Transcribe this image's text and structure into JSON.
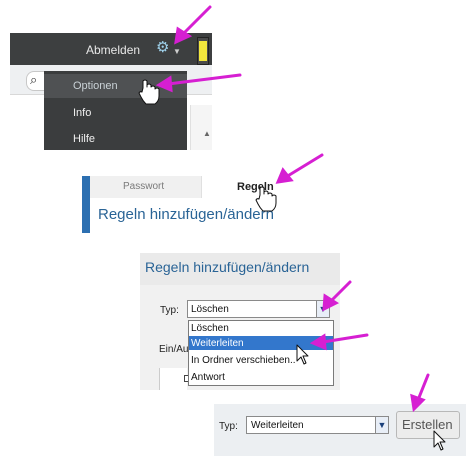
{
  "panel1": {
    "logout_label": "Abmelden",
    "menu": [
      {
        "label": "Optionen"
      },
      {
        "label": "Info"
      },
      {
        "label": "Hilfe"
      }
    ],
    "icons": {
      "settings": "gear-icon",
      "search": "search-icon"
    }
  },
  "panel2": {
    "tabs": [
      {
        "label": "Passwort"
      },
      {
        "label": "Regeln"
      }
    ],
    "title": "Regeln hinzufügen/ändern"
  },
  "panel3": {
    "title": "Regeln hinzufügen/ändern",
    "typ_label": "Typ:",
    "selected": "Löschen",
    "options": [
      "Löschen",
      "Weiterleiten",
      "In Ordner verschieben..",
      "Antwort"
    ],
    "highlighted_option": "Weiterleiten",
    "partial_label": "Ein/Au"
  },
  "panel4": {
    "typ_label": "Typ:",
    "selected": "Weiterleiten",
    "button_label": "Erstellen"
  },
  "colors": {
    "arrow": "#d61fd2",
    "link_blue": "#2a6496",
    "accent": "#2c6fb1",
    "highlight": "#3377cc"
  }
}
